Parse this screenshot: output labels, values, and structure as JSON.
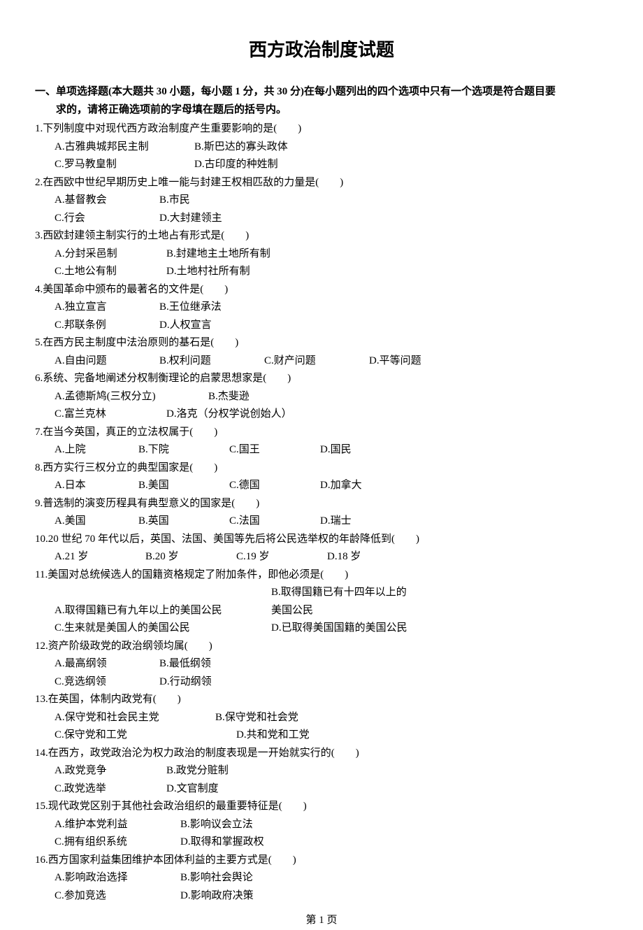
{
  "title": "西方政治制度试题",
  "section": {
    "header1": "一、单项选择题(本大题共 30 小题，每小题 1 分，共 30 分)在每小题列出的四个选项中只有一个选项是符合题目要",
    "header2": "求的，请将正确选项前的字母填在题后的括号内。"
  },
  "questions": [
    {
      "num": "1",
      "text": "1.下列制度中对现代西方政治制度产生重要影响的是(　　)",
      "opts": [
        [
          "A.古雅典城邦民主制",
          "B.斯巴达的寡头政体"
        ],
        [
          "C.罗马教皇制",
          "D.古印度的种姓制"
        ]
      ]
    },
    {
      "num": "2",
      "text": "2.在西欧中世纪早期历史上唯一能与封建王权相匹敌的力量是(　　)",
      "opts": [
        [
          "A.基督教会",
          "B.市民"
        ],
        [
          "C.行会",
          "D.大封建领主"
        ]
      ]
    },
    {
      "num": "3",
      "text": "3.西欧封建领主制实行的土地占有形式是(　　)",
      "opts": [
        [
          "A.分封采邑制",
          "B.封建地主土地所有制"
        ],
        [
          "C.土地公有制",
          "D.土地村社所有制"
        ]
      ]
    },
    {
      "num": "4",
      "text": "4.美国革命中颁布的最著名的文件是(　　)",
      "opts": [
        [
          "A.独立宣言",
          "B.王位继承法"
        ],
        [
          "C.邦联条例",
          "D.人权宣言"
        ]
      ]
    },
    {
      "num": "5",
      "text": "5.在西方民主制度中法治原则的基石是(　　)",
      "opts": [
        [
          "A.自由问题",
          "B.权利问题",
          "C.财产问题",
          "D.平等问题"
        ]
      ]
    },
    {
      "num": "6",
      "text": "6.系统、完备地阐述分权制衡理论的启蒙思想家是(　　)",
      "opts": [
        [
          "A.孟德斯鸠(三权分立)",
          "B.杰斐逊"
        ],
        [
          "C.富兰克林",
          "D.洛克（分权学说创始人）"
        ]
      ]
    },
    {
      "num": "7",
      "text": "7.在当今英国，真正的立法权属于(　　)",
      "opts": [
        [
          "A.上院",
          "B.下院",
          "C.国王",
          "D.国民"
        ]
      ]
    },
    {
      "num": "8",
      "text": "8.西方实行三权分立的典型国家是(　　)",
      "opts": [
        [
          "A.日本",
          "B.美国",
          "C.德国",
          "D.加拿大"
        ]
      ]
    },
    {
      "num": "9",
      "text": "9.普选制的演变历程具有典型意义的国家是(　　)",
      "opts": [
        [
          "A.美国",
          "B.英国",
          "C.法国",
          "D.瑞士"
        ]
      ]
    },
    {
      "num": "10",
      "text": "10.20 世纪 70 年代以后，英国、法国、美国等先后将公民选举权的年龄降低到(　　)",
      "opts": [
        [
          "A.21 岁",
          "B.20 岁",
          "C.19 岁",
          "D.18 岁"
        ]
      ]
    },
    {
      "num": "11",
      "text": "11.美国对总统候选人的国籍资格规定了附加条件，即他必须是(　　)",
      "opts": [
        [
          "A.取得国籍已有九年以上的美国公民",
          "B.取得国籍已有十四年以上的美国公民"
        ],
        [
          "C.生来就是美国人的美国公民",
          "D.已取得美国国籍的美国公民"
        ]
      ]
    },
    {
      "num": "12",
      "text": "12.资产阶级政党的政治纲领均属(　　)",
      "opts": [
        [
          "A.最高纲领",
          "B.最低纲领"
        ],
        [
          "C.竞选纲领",
          "D.行动纲领"
        ]
      ]
    },
    {
      "num": "13",
      "text": "13.在英国，体制内政党有(　　)",
      "opts": [
        [
          "A.保守党和社会民主党",
          "B.保守党和社会党"
        ],
        [
          "C.保守党和工党",
          "D.共和党和工党"
        ]
      ]
    },
    {
      "num": "14",
      "text": "14.在西方，政党政治沦为权力政治的制度表现是一开始就实行的(　　)",
      "opts": [
        [
          "A.政党竞争",
          "B.政党分赃制"
        ],
        [
          "C.政党选举",
          "D.文官制度"
        ]
      ]
    },
    {
      "num": "15",
      "text": "15.现代政党区别于其他社会政治组织的最重要特征是(　　)",
      "opts": [
        [
          "A.维护本党利益",
          "B.影响议会立法"
        ],
        [
          "C.拥有组织系统",
          "D.取得和掌握政权"
        ]
      ]
    },
    {
      "num": "16",
      "text": "16.西方国家利益集团维护本团体利益的主要方式是(　　)",
      "opts": [
        [
          "A.影响政治选择",
          "B.影响社会舆论"
        ],
        [
          "C.参加竞选",
          "D.影响政府决策"
        ]
      ]
    }
  ],
  "pageNum": "第 1 页"
}
